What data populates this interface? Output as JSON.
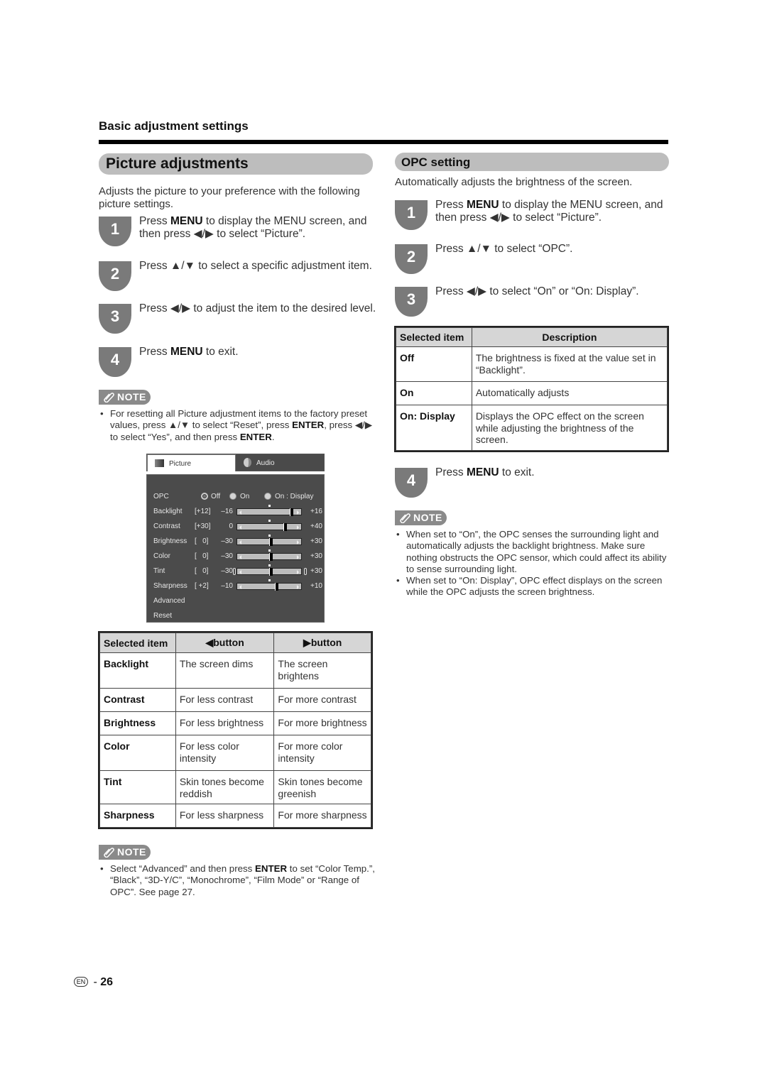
{
  "header": {
    "section_title": "Basic adjustment settings"
  },
  "picture": {
    "title": "Picture adjustments",
    "intro": "Adjusts the picture to your preference with the following picture settings.",
    "steps": [
      {
        "num": "1",
        "pre": "Press ",
        "bold": "MENU",
        "post": " to display the MENU screen, and then press ◀/▶ to select “Picture”."
      },
      {
        "num": "2",
        "text": "Press ▲/▼ to select a specific adjustment item."
      },
      {
        "num": "3",
        "text": "Press ◀/▶ to adjust the item to the desired level."
      },
      {
        "num": "4",
        "pre": "Press ",
        "bold": "MENU",
        "post": " to exit."
      }
    ],
    "note_label": "NOTE",
    "note1": {
      "t1": "For resetting all Picture adjustment items to the factory preset values, press ▲/▼ to select “Reset”, press ",
      "b1": "ENTER",
      "t2": ", press ◀/▶ to select “Yes”, and then press ",
      "b2": "ENTER",
      "t3": "."
    },
    "tv_menu": {
      "tabs": [
        {
          "label": "Picture",
          "icon": "picture-icon",
          "active": true
        },
        {
          "label": "Audio",
          "icon": "audio-icon",
          "active": false
        }
      ],
      "opc": {
        "label": "OPC",
        "options": [
          "Off",
          "On",
          "On : Display"
        ],
        "selected": "Off"
      },
      "rows": [
        {
          "label": "Backlight",
          "current": "[+12]",
          "min": "–16",
          "max": "+16",
          "value": 12,
          "range": [
            -16,
            16
          ]
        },
        {
          "label": "Contrast",
          "current": "[+30]",
          "min": "0",
          "max": "+40",
          "value": 30,
          "range": [
            0,
            40
          ]
        },
        {
          "label": "Brightness",
          "current": "[   0]",
          "min": "–30",
          "max": "+30",
          "value": 0,
          "range": [
            -30,
            30
          ]
        },
        {
          "label": "Color",
          "current": "[   0]",
          "min": "–30",
          "max": "+30",
          "value": 0,
          "range": [
            -30,
            30
          ]
        },
        {
          "label": "Tint",
          "current": "[   0]",
          "min": "–30",
          "max": "+30",
          "value": 0,
          "range": [
            -30,
            30
          ],
          "end_markers": true
        },
        {
          "label": "Sharpness",
          "current": "[ +2]",
          "min": "–10",
          "max": "+10",
          "value": 2,
          "range": [
            -10,
            10
          ]
        }
      ],
      "extra_items": [
        "Advanced",
        "Reset"
      ]
    },
    "table": {
      "headers": [
        "Selected item",
        "◀button",
        "▶button"
      ],
      "rows": [
        [
          "Backlight",
          "The screen dims",
          "The screen brightens"
        ],
        [
          "Contrast",
          "For less contrast",
          "For more contrast"
        ],
        [
          "Brightness",
          "For less brightness",
          "For more brightness"
        ],
        [
          "Color",
          "For less color intensity",
          "For more color intensity"
        ],
        [
          "Tint",
          "Skin tones become reddish",
          "Skin tones become greenish"
        ],
        [
          "Sharpness",
          "For less sharpness",
          "For more sharpness"
        ]
      ]
    },
    "note2": {
      "t1": "Select “Advanced” and then press ",
      "b1": "ENTER",
      "t2": " to set “Color Temp.”, “Black”, “3D-Y/C”, “Monochrome”, “Film Mode” or “Range of OPC”. See page 27."
    }
  },
  "opc": {
    "title": "OPC setting",
    "intro": "Automatically adjusts the brightness of the screen.",
    "steps": [
      {
        "num": "1",
        "pre": "Press ",
        "bold": "MENU",
        "post": " to display the MENU screen, and then press ◀/▶ to select “Picture”."
      },
      {
        "num": "2",
        "text": "Press ▲/▼ to select “OPC”."
      },
      {
        "num": "3",
        "text": "Press ◀/▶ to select “On” or “On: Display”."
      },
      {
        "num": "4",
        "pre": "Press ",
        "bold": "MENU",
        "post": " to exit."
      }
    ],
    "table": {
      "headers": [
        "Selected item",
        "Description"
      ],
      "rows": [
        [
          "Off",
          "The brightness is fixed at the value set in “Backlight”."
        ],
        [
          "On",
          "Automatically adjusts"
        ],
        [
          "On: Display",
          "Displays the OPC effect on the screen while adjusting the brightness of the screen."
        ]
      ]
    },
    "note_label": "NOTE",
    "notes": [
      "When set to “On”, the OPC senses the surrounding light and automatically adjusts the backlight brightness. Make sure nothing obstructs the OPC sensor, which could affect its ability to sense surrounding light.",
      "When set to “On: Display”, OPC effect displays on the screen while the OPC adjusts the screen brightness."
    ]
  },
  "footer": {
    "lang": "EN",
    "separator": "-",
    "page": "26"
  }
}
